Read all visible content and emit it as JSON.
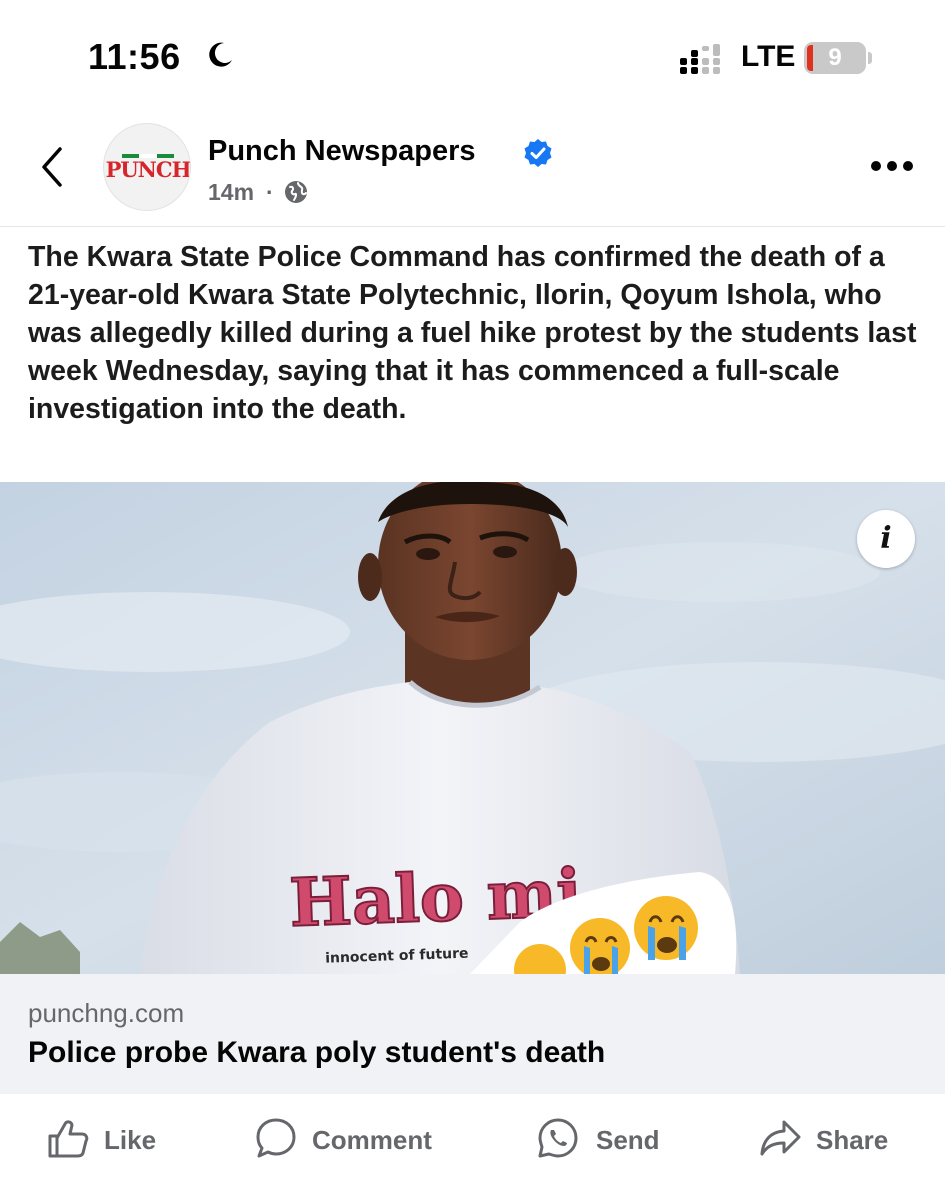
{
  "status_bar": {
    "time": "11:56",
    "network": "LTE",
    "battery": "9",
    "battery_color": "#e0301e"
  },
  "post": {
    "page_logo_text": "PUNCH",
    "page_name": "Punch Newspapers",
    "verified_color": "#1877f2",
    "time": "14m",
    "separator": "·",
    "audience_icon": "globe-icon",
    "text": "The Kwara State Police Command has confirmed the death of a 21-year-old Kwara State Polytechnic, Ilorin, Qoyum Ishola, who was allegedly killed during a fuel hike protest by the students last week Wednesday, saying that it has commenced a full-scale investigation into the death."
  },
  "link": {
    "info_glyph": "i",
    "domain": "punchng.com",
    "title": "Police probe Kwara poly student's death",
    "image_shirt_text": "Halo mi",
    "image_shirt_subtext": "innocent of future"
  },
  "actions": {
    "like": "Like",
    "comment": "Comment",
    "send": "Send",
    "share": "Share"
  }
}
